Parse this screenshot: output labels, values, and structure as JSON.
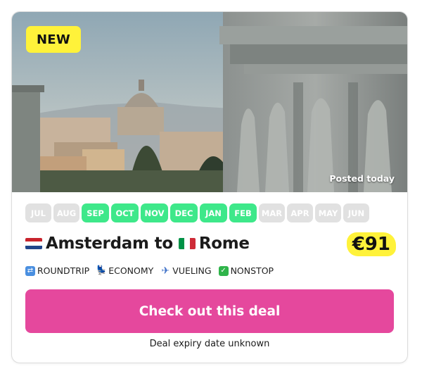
{
  "badge": "NEW",
  "posted": "Posted today",
  "months": [
    {
      "label": "JUL",
      "active": false
    },
    {
      "label": "AUG",
      "active": false
    },
    {
      "label": "SEP",
      "active": true
    },
    {
      "label": "OCT",
      "active": true
    },
    {
      "label": "NOV",
      "active": true
    },
    {
      "label": "DEC",
      "active": true
    },
    {
      "label": "JAN",
      "active": true
    },
    {
      "label": "FEB",
      "active": true
    },
    {
      "label": "MAR",
      "active": false
    },
    {
      "label": "APR",
      "active": false
    },
    {
      "label": "MAY",
      "active": false
    },
    {
      "label": "JUN",
      "active": false
    }
  ],
  "route": {
    "origin": "Amsterdam",
    "connector": "to",
    "destination": "Rome"
  },
  "price": "€91",
  "tags": [
    {
      "label": "ROUNDTRIP",
      "icon": "roundtrip-icon"
    },
    {
      "label": "ECONOMY",
      "icon": "seat-icon"
    },
    {
      "label": "VUELING",
      "icon": "plane-icon"
    },
    {
      "label": "NONSTOP",
      "icon": "check-icon"
    }
  ],
  "cta": "Check out this deal",
  "expiry": "Deal expiry date unknown",
  "colors": {
    "accent": "#e5489d",
    "month_active": "#3ee88a",
    "month_inactive": "#e1e1e1",
    "highlight": "#fff23a"
  }
}
